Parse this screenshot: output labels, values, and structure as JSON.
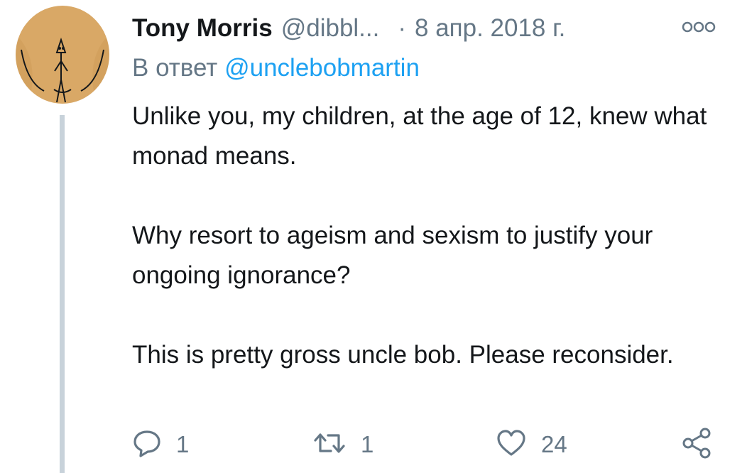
{
  "tweet": {
    "author": {
      "display_name": "Tony Morris",
      "handle": "@dibbl..."
    },
    "separator": "·",
    "date": "8 апр. 2018 г.",
    "reply_to": {
      "prefix": "В ответ",
      "mention": "@unclebobmartin"
    },
    "paragraphs": [
      "Unlike you, my children, at the age of 12, knew what monad means.",
      "Why resort to ageism and sexism to justify your ongoing ignorance?",
      "This is pretty gross uncle bob. Please reconsider."
    ],
    "actions": {
      "reply_count": "1",
      "retweet_count": "1",
      "like_count": "24"
    }
  },
  "icons": {
    "more": "more-options-icon",
    "reply": "reply-icon",
    "retweet": "retweet-icon",
    "like": "heart-icon",
    "share": "share-icon"
  },
  "colors": {
    "text": "#14171a",
    "muted": "#657786",
    "link": "#1da1f2",
    "thread_line": "#c8d2da",
    "avatar_bg": "#d9a866"
  }
}
